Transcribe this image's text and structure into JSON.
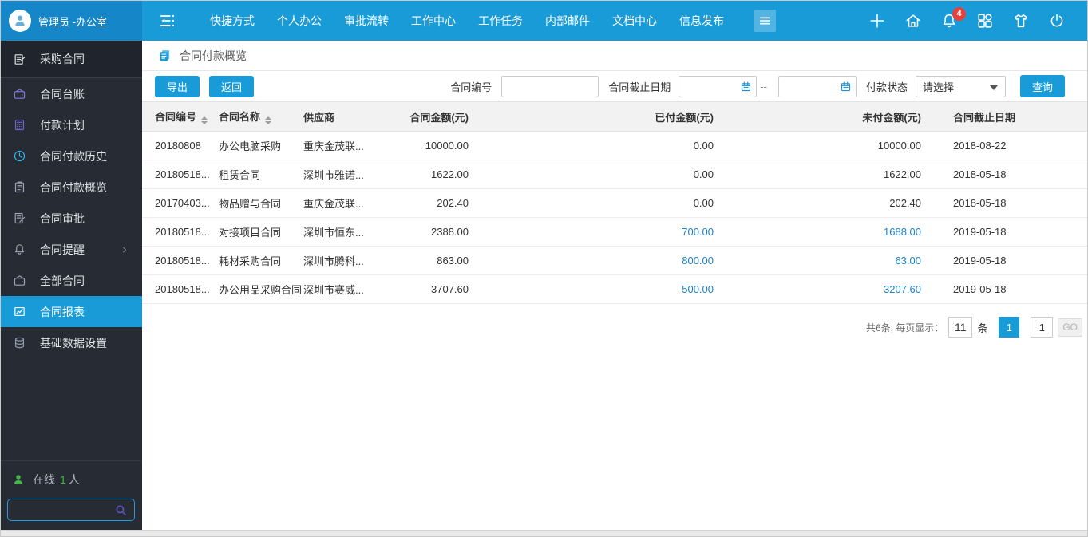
{
  "colors": {
    "accent": "#199bd8",
    "topbar_left": "#1587c8",
    "sidebar_bg": "#262b34",
    "link_blue": "#1e82c8",
    "badge_red": "#e8413c",
    "online_green": "#42b649",
    "search_border": "#1f9ce4",
    "search_purple": "#5c50b9"
  },
  "topbar": {
    "user_name": "管理员 -办公室",
    "nav": [
      "快捷方式",
      "个人办公",
      "审批流转",
      "工作中心",
      "工作任务",
      "内部邮件",
      "文档中心",
      "信息发布"
    ],
    "icons": [
      "plus-icon",
      "home-icon",
      "bell-icon",
      "grid-icon",
      "shirt-icon",
      "power-icon"
    ],
    "notification_count": "4"
  },
  "sidebar": {
    "items": [
      {
        "label": "采购合同",
        "icon": "doc-edit-icon",
        "icon_color": "#dfe3e9",
        "module": true
      },
      {
        "label": "合同台账",
        "icon": "wallet-icon",
        "icon_color": "#8277d8"
      },
      {
        "label": "付款计划",
        "icon": "calculator-icon",
        "icon_color": "#7064cb"
      },
      {
        "label": "合同付款历史",
        "icon": "clock-icon",
        "icon_color": "#2fb7ef"
      },
      {
        "label": "合同付款概览",
        "icon": "clipboard-icon",
        "icon_color": "#9aa3b1"
      },
      {
        "label": "合同审批",
        "icon": "doc-pen-icon",
        "icon_color": "#9aa3b1"
      },
      {
        "label": "合同提醒",
        "icon": "bell-icon",
        "icon_color": "#9aa3b1",
        "chevron": true
      },
      {
        "label": "全部合同",
        "icon": "wallet-icon",
        "icon_color": "#9aa3b1"
      },
      {
        "label": "合同报表",
        "icon": "chart-icon",
        "icon_color": "#ffffff",
        "active": true
      },
      {
        "label": "基础数据设置",
        "icon": "database-icon",
        "icon_color": "#8d9aab"
      }
    ],
    "online_prefix": "在线",
    "online_count": "1",
    "online_suffix": "人"
  },
  "page": {
    "title": "合同付款概览"
  },
  "toolbar": {
    "export_label": "导出",
    "back_label": "返回"
  },
  "filters": {
    "contract_no_label": "合同编号",
    "date_label": "合同截止日期",
    "date_separator": "--",
    "status_label": "付款状态",
    "status_value": "请选择",
    "search_label": "查询"
  },
  "table": {
    "columns": [
      {
        "label": "合同编号",
        "sortable": true
      },
      {
        "label": "合同名称",
        "sortable": true
      },
      {
        "label": "供应商",
        "sortable": false
      },
      {
        "label": "合同金额(元)",
        "sortable": false
      },
      {
        "label": "已付金额(元)",
        "sortable": false
      },
      {
        "label": "未付金额(元)",
        "sortable": false
      },
      {
        "label": "合同截止日期",
        "sortable": false
      }
    ],
    "rows": [
      {
        "contract_no": "20180808",
        "name": "办公电脑采购",
        "supplier": "重庆金茂联...",
        "amount": "10000.00",
        "paid": "0.00",
        "unpaid": "10000.00",
        "due_date": "2018-08-22",
        "linked": false
      },
      {
        "contract_no": "20180518...",
        "name": "租赁合同",
        "supplier": "深圳市雅诺...",
        "amount": "1622.00",
        "paid": "0.00",
        "unpaid": "1622.00",
        "due_date": "2018-05-18",
        "linked": false
      },
      {
        "contract_no": "20170403...",
        "name": "物品赠与合同",
        "supplier": "重庆金茂联...",
        "amount": "202.40",
        "paid": "0.00",
        "unpaid": "202.40",
        "due_date": "2018-05-18",
        "linked": false
      },
      {
        "contract_no": "20180518...",
        "name": "对接项目合同",
        "supplier": "深圳市恒东...",
        "amount": "2388.00",
        "paid": "700.00",
        "unpaid": "1688.00",
        "due_date": "2019-05-18",
        "linked": true
      },
      {
        "contract_no": "20180518...",
        "name": "耗材采购合同",
        "supplier": "深圳市腾科...",
        "amount": "863.00",
        "paid": "800.00",
        "unpaid": "63.00",
        "due_date": "2019-05-18",
        "linked": true
      },
      {
        "contract_no": "20180518...",
        "name": "办公用品采购合同",
        "supplier": "深圳市赛威...",
        "amount": "3707.60",
        "paid": "500.00",
        "unpaid": "3207.60",
        "due_date": "2019-05-18",
        "linked": true
      }
    ]
  },
  "pagination": {
    "summary": "共6条, 每页显示：",
    "page_size": "11",
    "unit_label": "条",
    "current_page": "1",
    "goto_value": "1",
    "go_label": "GO"
  }
}
